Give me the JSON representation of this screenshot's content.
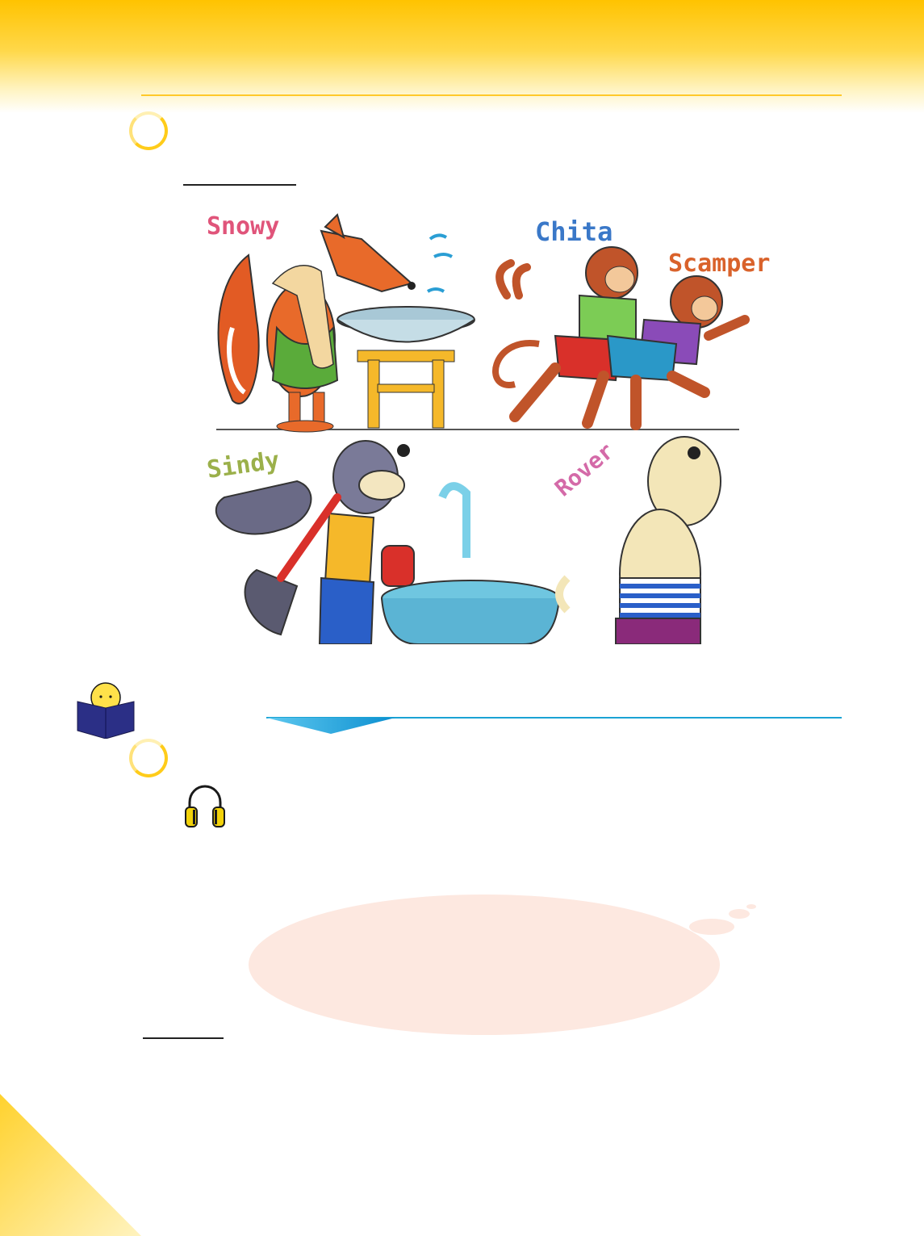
{
  "illustration": {
    "names": [
      "Snowy",
      "Chita",
      "Scamper",
      "Sindy",
      "Rover"
    ],
    "colors": {
      "snowy": "#e0547a",
      "chita": "#3a78c8",
      "scamper": "#d9622b",
      "sindy": "#9bb04a",
      "rover": "#d46aa8"
    }
  },
  "icons": {
    "reader": "reader-book-icon",
    "headphones": "headphones-icon"
  },
  "colors": {
    "accent_yellow": "#ffc300",
    "accent_blue": "#1aa3d4",
    "book_navy": "#2b2f86",
    "thought_bubble": "#fde8e0"
  }
}
